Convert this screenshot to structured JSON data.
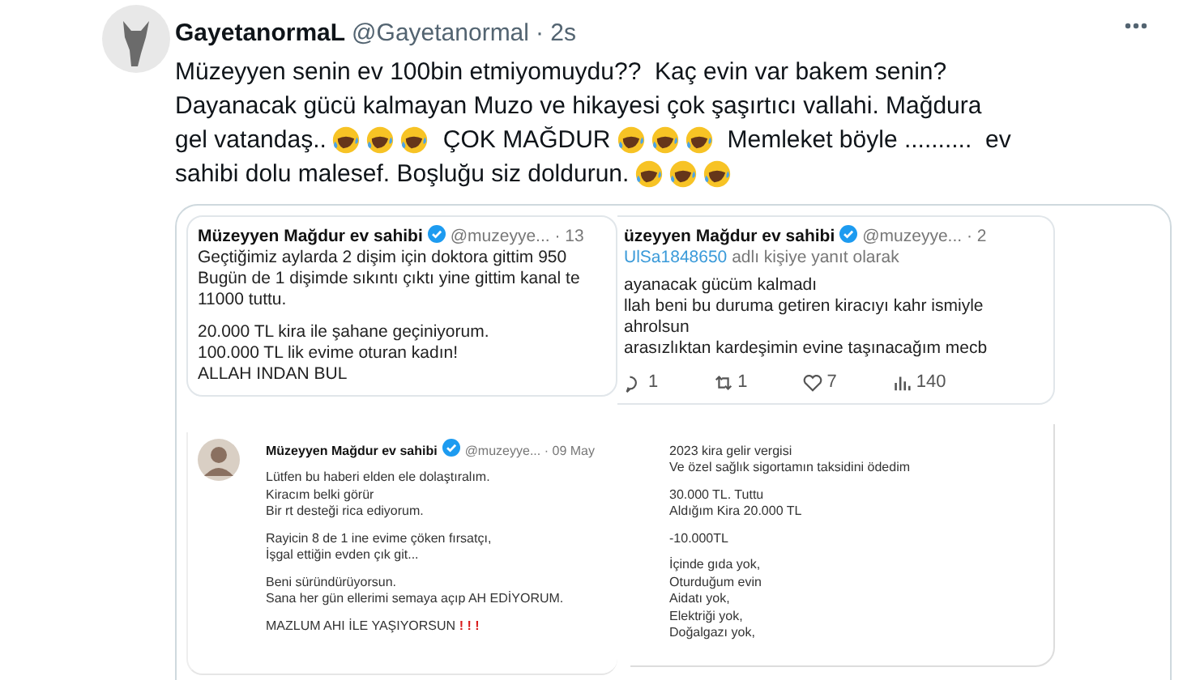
{
  "tweet": {
    "name": "GayetanormaL",
    "handle": "@Gayetanormal",
    "time": "· 2s",
    "lines": [
      [
        {
          "kind": "text",
          "value": "Müzeyyen senin ev 100bin etmiyomuydu??  Kaç evin var bakem senin?"
        }
      ],
      [
        {
          "kind": "text",
          "value": "Dayanacak gücü kalmayan Muzo ve hikayesi çok şaşırtıcı vallahi. Mağdura"
        }
      ],
      [
        {
          "kind": "text",
          "value": "gel vatandaş.."
        },
        {
          "kind": "emoji"
        },
        {
          "kind": "emoji"
        },
        {
          "kind": "emoji"
        },
        {
          "kind": "text",
          "value": "ÇOK MAĞDUR"
        },
        {
          "kind": "emoji"
        },
        {
          "kind": "emoji"
        },
        {
          "kind": "emoji"
        },
        {
          "kind": "text",
          "value": "Memleket böyle ..........  ev"
        }
      ],
      [
        {
          "kind": "text",
          "value": "sahibi dolu malesef. Boşluğu siz doldurun."
        },
        {
          "kind": "emoji"
        },
        {
          "kind": "emoji"
        },
        {
          "kind": "emoji"
        }
      ]
    ]
  },
  "media": {
    "left": [
      {
        "kind": "post",
        "name": "Müzeyyen Mağdur ev sahibi",
        "handle": "@muzeyye...",
        "time": "· 13",
        "paragraphs": [
          [
            "Geçtiğimiz  aylarda 2 dişim için doktora gittim 950",
            "Bugün de 1 dişimde sıkıntı çıktı yine gittim kanal te",
            "11000 tuttu."
          ],
          [
            "20.000 TL kira ile şahane geçiniyorum.",
            "100.000 TL lik evime oturan kadın!",
            "ALLAH INDAN BUL"
          ]
        ]
      },
      {
        "kind": "quote",
        "name": "Müzeyyen Mağdur ev sahibi",
        "handle": "@muzeyye...",
        "time": "· 09 May",
        "paragraphs": [
          [
            "Lütfen bu haberi elden ele dolaştıralım.",
            "Kiracım belki görür",
            "Bir rt desteği rica ediyorum."
          ],
          [
            "Rayicin 8 de 1 ine evime çöken fırsatçı,",
            "İşgal ettiğin evden çık git..."
          ],
          [
            "Beni süründürüyorsun.",
            "Sana her gün ellerimi semaya açıp AH EDİYORUM."
          ],
          [
            "MAZLUM AHI İLE YAŞIYORSUN"
          ]
        ],
        "alarm": "! ! !"
      }
    ],
    "right": [
      {
        "kind": "post",
        "name": "üzeyyen Mağdur ev sahibi",
        "handle": "@muzeyye...",
        "time": "· 2",
        "reply_to": "UlSa1848650",
        "reply_suffix": "adlı kişiye yanıt olarak",
        "paragraphs": [
          [
            "ayanacak gücüm kalmadı",
            "llah beni bu duruma getiren kiracıyı kahr ismiyle",
            "ahrolsun",
            "arasızlıktan kardeşimin evine taşınacağım mecb"
          ]
        ],
        "actions": [
          {
            "kind": "reply",
            "count": "1"
          },
          {
            "kind": "retweet",
            "count": "1"
          },
          {
            "kind": "like",
            "count": "7"
          },
          {
            "kind": "views",
            "count": "140"
          }
        ]
      },
      {
        "kind": "plain",
        "paragraphs": [
          [
            "2023 kira gelir vergisi",
            "Ve özel sağlık sigortamın taksidini ödedim"
          ],
          [
            "30.000 TL. Tuttu",
            "Aldığım Kira 20.000 TL"
          ],
          [
            "-10.000TL"
          ],
          [
            "İçinde gıda yok,",
            "Oturduğum evin",
            "Aidatı yok,",
            "Elektriği yok,",
            "Doğalgazı  yok,"
          ]
        ]
      }
    ]
  }
}
